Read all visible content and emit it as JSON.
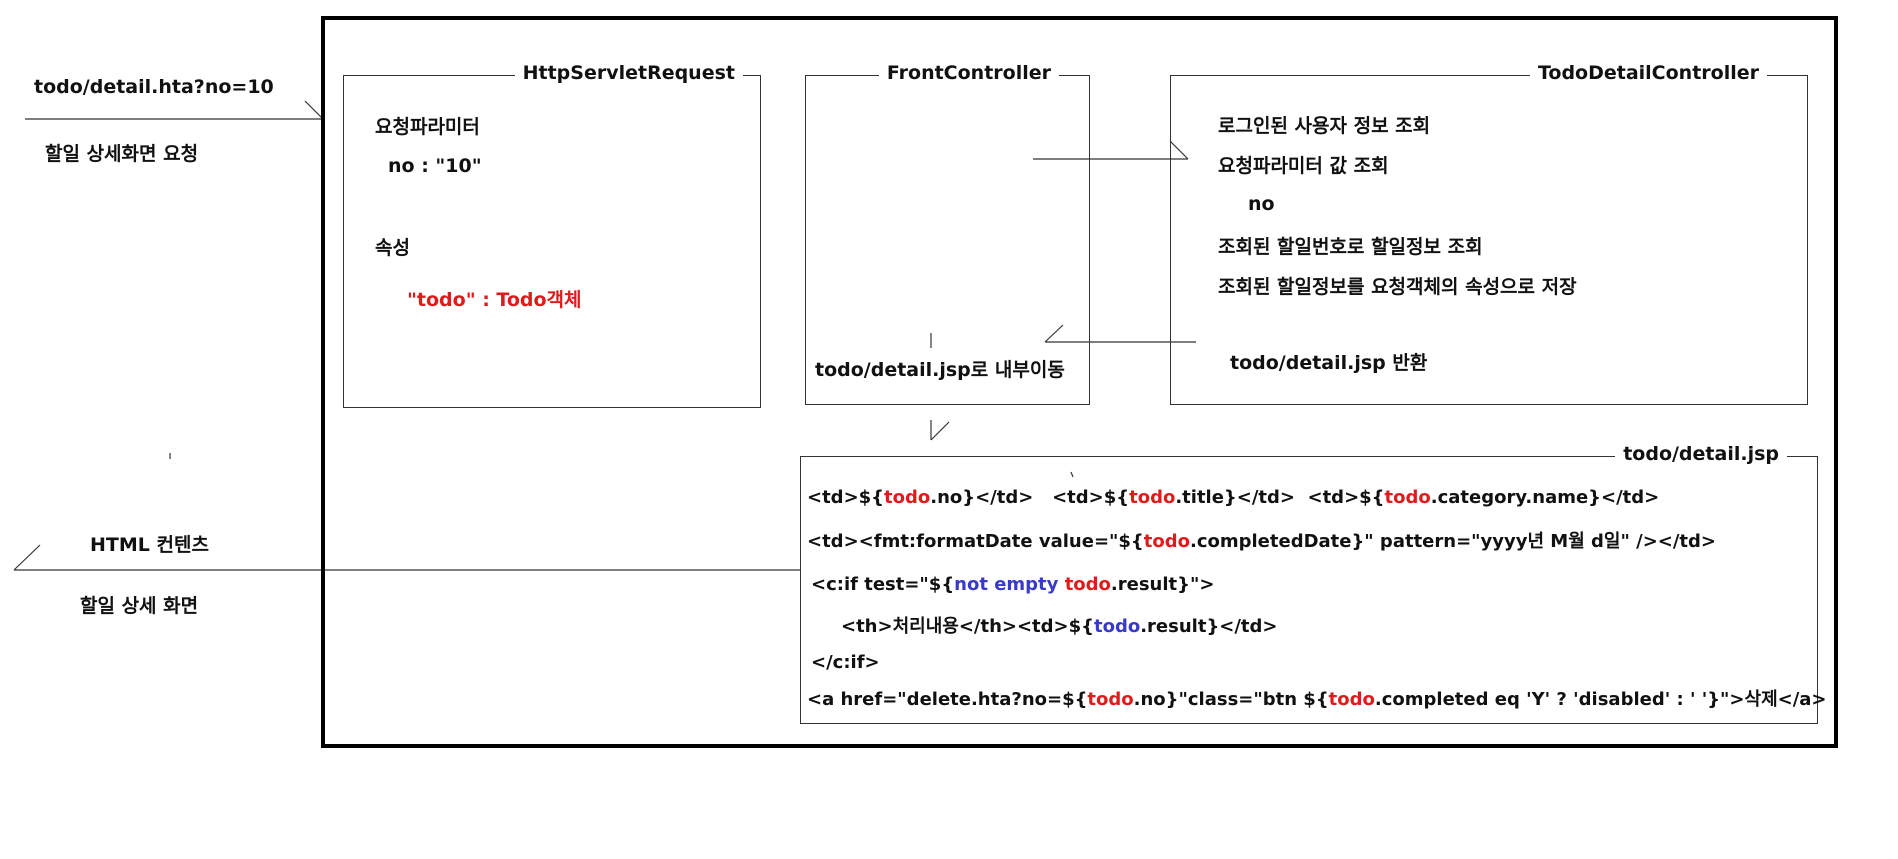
{
  "colors": {
    "red": "#e01b1b",
    "blue": "#3a3ac9"
  },
  "left": {
    "request_url": "todo/detail.hta?no=10",
    "request_desc": "할일 상세화면 요청",
    "response_title": "HTML 컨텐츠",
    "response_desc": "할일 상세 화면"
  },
  "request_box": {
    "title": "HttpServletRequest",
    "param_heading": "요청파라미터",
    "param_value": "no : \"10\"",
    "attr_heading": "속성",
    "attr_value": "\"todo\" : Todo객체"
  },
  "front_box": {
    "title": "FrontController",
    "forward_text": "todo/detail.jsp로 내부이동"
  },
  "controller_box": {
    "title": "TodoDetailController",
    "steps": [
      "로그인된 사용자 정보 조회",
      "요청파라미터 값 조회",
      "no",
      "조회된 할일번호로 할일정보 조회",
      "조회된 할일정보를 요청객체의 속성으로 저장"
    ],
    "return_text": "todo/detail.jsp 반환"
  },
  "jsp_box": {
    "title": "todo/detail.jsp",
    "lines": [
      [
        {
          "t": "<td>${",
          "c": ""
        },
        {
          "t": "todo",
          "c": "red"
        },
        {
          "t": ".no}</td>   <td>${",
          "c": ""
        },
        {
          "t": "todo",
          "c": "red"
        },
        {
          "t": ".title}</td>  <td>${",
          "c": ""
        },
        {
          "t": "todo",
          "c": "red"
        },
        {
          "t": ".category.name}</td>",
          "c": ""
        }
      ],
      [
        {
          "t": "<td><fmt:formatDate value=\"${",
          "c": ""
        },
        {
          "t": "todo",
          "c": "red"
        },
        {
          "t": ".completedDate}\" pattern=\"yyyy년 M월 d일\" /></td>",
          "c": ""
        }
      ],
      [
        {
          "t": "<c:if test=\"${",
          "c": ""
        },
        {
          "t": "not empty",
          "c": "blue"
        },
        {
          "t": " ",
          "c": ""
        },
        {
          "t": "todo",
          "c": "red"
        },
        {
          "t": ".result}\">",
          "c": ""
        }
      ],
      [
        {
          "t": "<th>처리내용</th><td>${",
          "c": ""
        },
        {
          "t": "todo",
          "c": "blue"
        },
        {
          "t": ".result}</td>",
          "c": ""
        }
      ],
      [
        {
          "t": "</c:if>",
          "c": ""
        }
      ],
      [
        {
          "t": "<a href=\"delete.hta?no=${",
          "c": ""
        },
        {
          "t": "todo",
          "c": "red"
        },
        {
          "t": ".no}\"class=\"btn ${",
          "c": ""
        },
        {
          "t": "todo",
          "c": "red"
        },
        {
          "t": ".completed eq 'Y' ? 'disabled' : ' '}\">삭제</a>",
          "c": ""
        }
      ]
    ]
  }
}
